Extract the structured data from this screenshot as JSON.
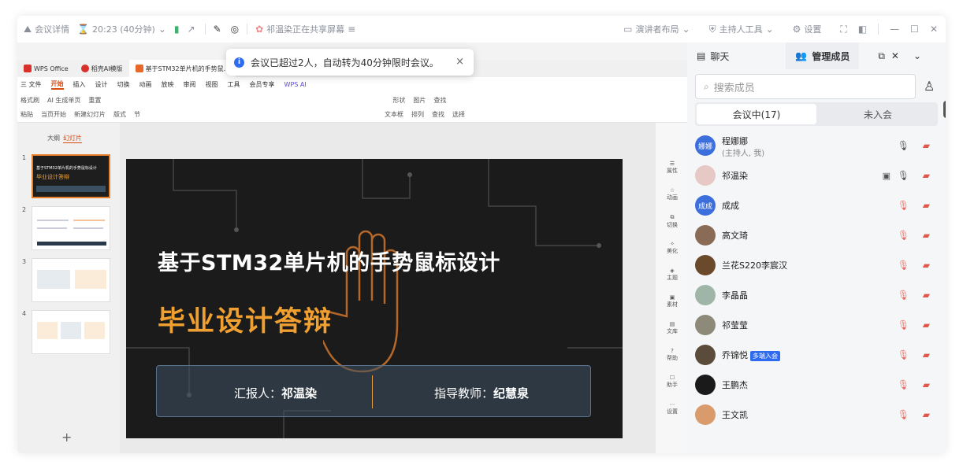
{
  "titlebar": {
    "meeting_info": "会议详情",
    "timer": "20:23 (40分钟)",
    "sharing_text": "祁温染正在共享屏幕",
    "right": {
      "presenter_layout": "演讲者布局",
      "host_tools": "主持人工具",
      "settings": "设置"
    }
  },
  "toast": {
    "message": "会议已超过2人，自动转为40分钟限时会议。",
    "close": "×"
  },
  "wps": {
    "tabs": [
      "WPS Office",
      "稻壳AI模版",
      "基于STM32单片机的手势鼠..."
    ],
    "menu": [
      "三 文件",
      "开始",
      "插入",
      "设计",
      "切换",
      "动画",
      "放映",
      "审阅",
      "视图",
      "工具",
      "会员专享",
      "WPS AI"
    ],
    "ribbon_row1": [
      "格式刷",
      "AI 生成单页",
      "重置",
      "形状",
      "图片",
      "查找"
    ],
    "ribbon_row2": [
      "粘贴",
      "当页开始",
      "新建幻灯片",
      "版式",
      "节",
      "文本框",
      "排列",
      "查找",
      "选择"
    ],
    "thumb_tabs": [
      "大纲",
      "幻灯片"
    ],
    "thumb_nums": [
      "1",
      "2",
      "3",
      "4"
    ],
    "thumb1_title": "基于STM32单片机的手势鼠标设计",
    "thumb1_sub": "毕业设计答辩",
    "add_slide": "+",
    "right_tools": [
      "属性",
      "动画",
      "切换",
      "美化",
      "主题",
      "素材",
      "文库",
      "帮助",
      "助手",
      "设置"
    ]
  },
  "slide": {
    "title": "基于STM32单片机的手势鼠标设计",
    "subtitle": "毕业设计答辩",
    "reporter_label": "汇报人：",
    "reporter_name": "祁温染",
    "advisor_label": "指导教师：",
    "advisor_name": "纪慧泉"
  },
  "panel": {
    "tab_chat": "聊天",
    "tab_members": "管理成员",
    "search_placeholder": "搜索成员",
    "seg_in": "会议中(17)",
    "seg_out": "未入会",
    "members": [
      {
        "name": "程娜娜",
        "sub": "(主持人, 我)",
        "avatar": "娜娜",
        "color": "#3d6fdc",
        "mic_on": true
      },
      {
        "name": "祁温染",
        "sub": "",
        "avatar": "",
        "color": "#e6c9c4",
        "mic_on": true,
        "sharing": true
      },
      {
        "name": "成成",
        "sub": "",
        "avatar": "成成",
        "color": "#3d6fdc",
        "mic_on": false
      },
      {
        "name": "高文琦",
        "sub": "",
        "avatar": "",
        "color": "#8a6b55",
        "mic_on": false
      },
      {
        "name": "兰花S220李宸汉",
        "sub": "",
        "avatar": "",
        "color": "#6b4a2c",
        "mic_on": false
      },
      {
        "name": "李晶晶",
        "sub": "",
        "avatar": "",
        "color": "#9fb5a8",
        "mic_on": false
      },
      {
        "name": "祁莹莹",
        "sub": "",
        "avatar": "",
        "color": "#8d8a7a",
        "mic_on": false
      },
      {
        "name": "乔锦悦",
        "sub": "",
        "avatar": "",
        "color": "#5a4b3a",
        "mic_on": false,
        "badge": "多端入会"
      },
      {
        "name": "王鹏杰",
        "sub": "",
        "avatar": "",
        "color": "#1a1a1a",
        "mic_on": false
      },
      {
        "name": "王文凯",
        "sub": "",
        "avatar": "",
        "color": "#d99a6c",
        "mic_on": false
      }
    ]
  }
}
